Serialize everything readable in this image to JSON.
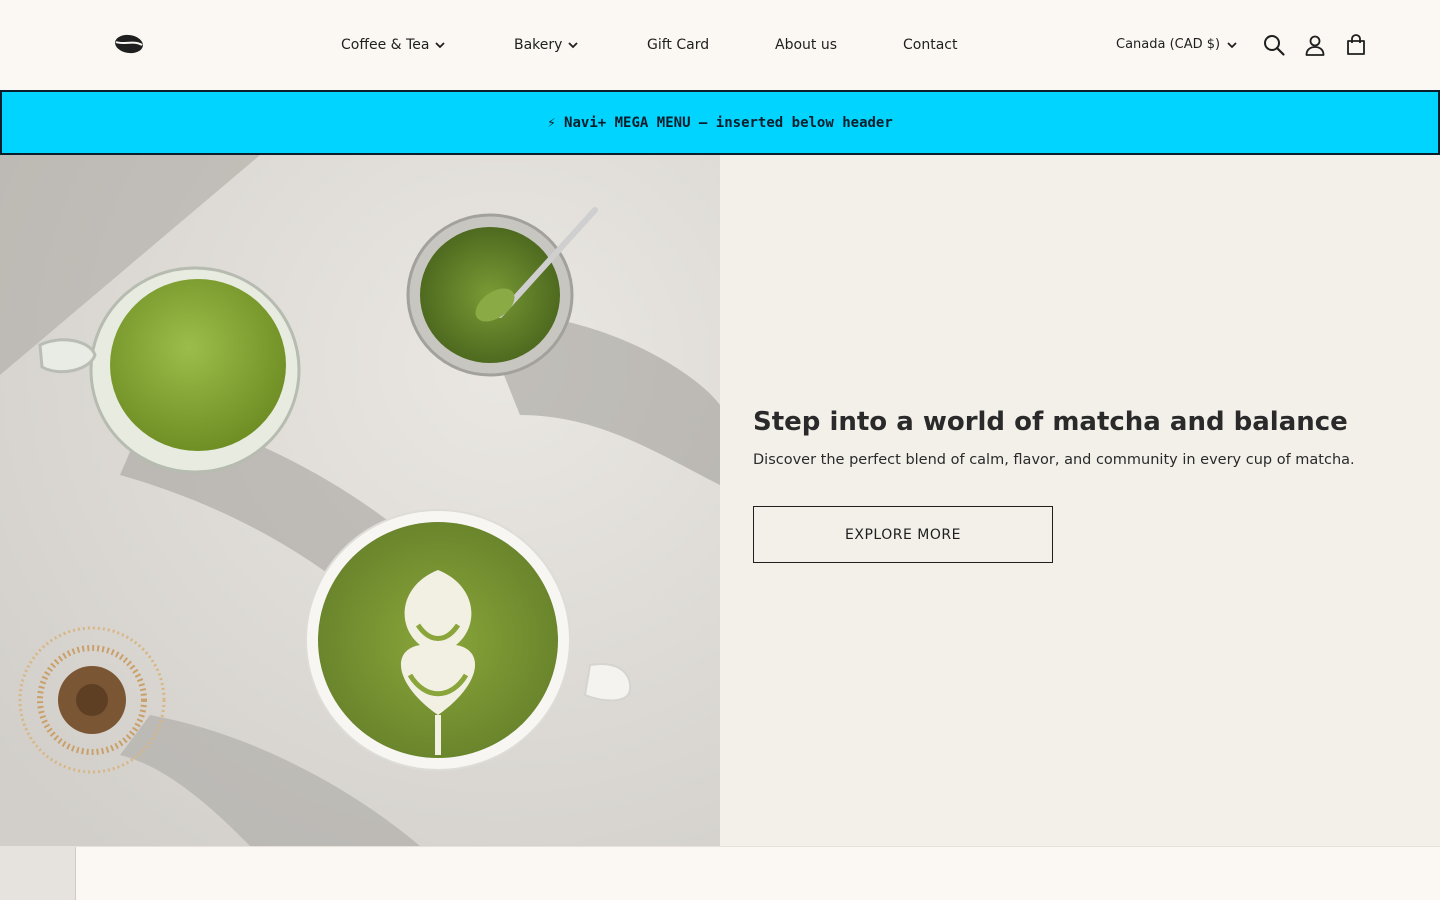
{
  "header": {
    "logo": "coffee-bean-logo",
    "nav": [
      {
        "label": "Coffee & Tea",
        "dropdown": true
      },
      {
        "label": "Bakery",
        "dropdown": true
      },
      {
        "label": "Gift Card",
        "dropdown": false
      },
      {
        "label": "About us",
        "dropdown": false
      },
      {
        "label": "Contact",
        "dropdown": false
      }
    ],
    "country": "Canada (CAD $)",
    "icons": [
      "search-icon",
      "account-icon",
      "cart-icon"
    ]
  },
  "mega_menu": {
    "text": "⚡ Navi+ MEGA MENU — inserted below header",
    "background": "#00d4ff",
    "border": "#0a1f2b"
  },
  "hero": {
    "image": "matcha-drinks-photo",
    "title": "Step into a world of matcha and balance",
    "subtitle": "Discover the perfect blend of calm, flavor, and community in every cup of matcha.",
    "button": "EXPLORE MORE"
  },
  "colors": {
    "page_bg": "#fbf8f3",
    "hero_panel_bg": "#f3f0ea",
    "text": "#1f1f1f"
  }
}
